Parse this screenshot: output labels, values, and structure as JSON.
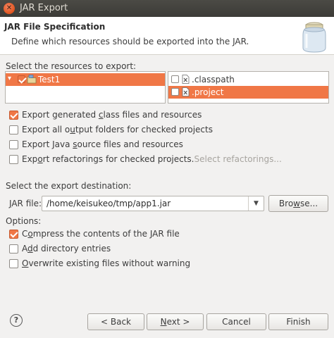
{
  "window": {
    "title": "JAR Export"
  },
  "header": {
    "title": "JAR File Specification",
    "description": "Define which resources should be exported into the JAR."
  },
  "resources": {
    "label": "Select the resources to export:",
    "tree": [
      {
        "label": "Test1",
        "checked": true,
        "expanded": true,
        "selected": true
      }
    ],
    "files": [
      {
        "label": ".classpath",
        "checked": false,
        "selected": false
      },
      {
        "label": ".project",
        "checked": false,
        "selected": true
      }
    ]
  },
  "export_options": {
    "generated": {
      "pre": "Export generated ",
      "u": "c",
      "post": "lass files and resources",
      "checked": true
    },
    "output": {
      "pre": "Export all o",
      "u": "u",
      "post": "tput folders for checked projects",
      "checked": false
    },
    "source": {
      "pre": "Export Java ",
      "u": "s",
      "post": "ource files and resources",
      "checked": false
    },
    "refactor": {
      "pre": "Exp",
      "u": "o",
      "post": "rt refactorings for checked projects.",
      "checked": false
    },
    "select_refactorings": "Select refactorings..."
  },
  "destination": {
    "label": "Select the export destination:",
    "jar_label_pre": "",
    "jar_label_u": "J",
    "jar_label_post": "AR file:",
    "jar_path": "/home/keisukeo/tmp/app1.jar",
    "browse": {
      "pre": "Bro",
      "u": "w",
      "post": "se..."
    }
  },
  "options": {
    "label": "Options:",
    "compress": {
      "pre": "C",
      "u": "o",
      "post": "mpress the contents of the JAR file",
      "checked": true
    },
    "dirs": {
      "pre": "A",
      "u": "d",
      "post": "d directory entries",
      "checked": false
    },
    "overwrite": {
      "pre": "",
      "u": "O",
      "post": "verwrite existing files without warning",
      "checked": false
    }
  },
  "buttons": {
    "back": "< Back",
    "next_pre": "",
    "next_u": "N",
    "next_post": "ext >",
    "cancel": "Cancel",
    "finish": "Finish",
    "help": "?"
  },
  "colors": {
    "accent": "#f07746",
    "titlebar": "#3c3b37",
    "background": "#f2f1f0"
  }
}
